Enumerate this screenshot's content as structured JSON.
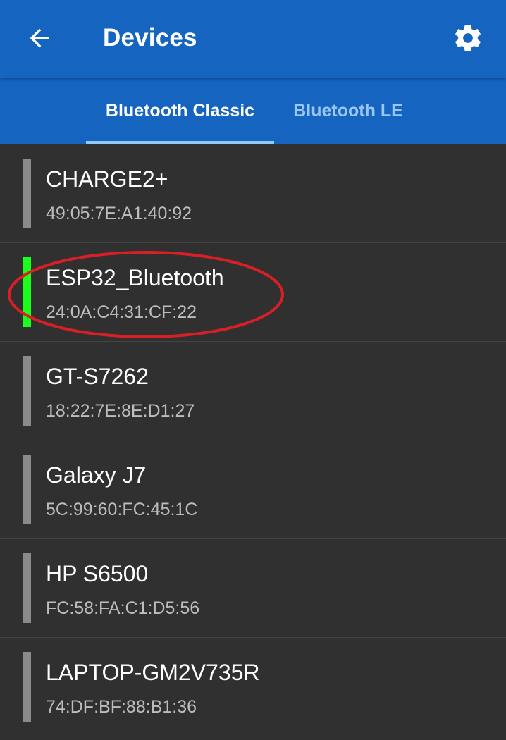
{
  "appbar": {
    "title": "Devices",
    "back_icon": "arrow-left-icon",
    "settings_icon": "gear-icon",
    "background_color": "#1565c0"
  },
  "tabs": [
    {
      "label": "Bluetooth Classic",
      "selected": true
    },
    {
      "label": "Bluetooth LE",
      "selected": false
    }
  ],
  "devices": [
    {
      "name": "CHARGE2+",
      "address": "49:05:7E:A1:40:92",
      "status_color": "#8a8a8a"
    },
    {
      "name": "ESP32_Bluetooth",
      "address": "24:0A:C4:31:CF:22",
      "status_color": "#1aff1a",
      "highlighted": true
    },
    {
      "name": "GT-S7262",
      "address": "18:22:7E:8E:D1:27",
      "status_color": "#8a8a8a"
    },
    {
      "name": "Galaxy J7",
      "address": "5C:99:60:FC:45:1C",
      "status_color": "#8a8a8a"
    },
    {
      "name": "HP S6500",
      "address": "FC:58:FA:C1:D5:56",
      "status_color": "#8a8a8a"
    },
    {
      "name": "LAPTOP-GM2V735R",
      "address": "74:DF:BF:88:B1:36",
      "status_color": "#8a8a8a"
    }
  ],
  "annotation": {
    "shape": "ellipse",
    "color": "#d81f26"
  }
}
